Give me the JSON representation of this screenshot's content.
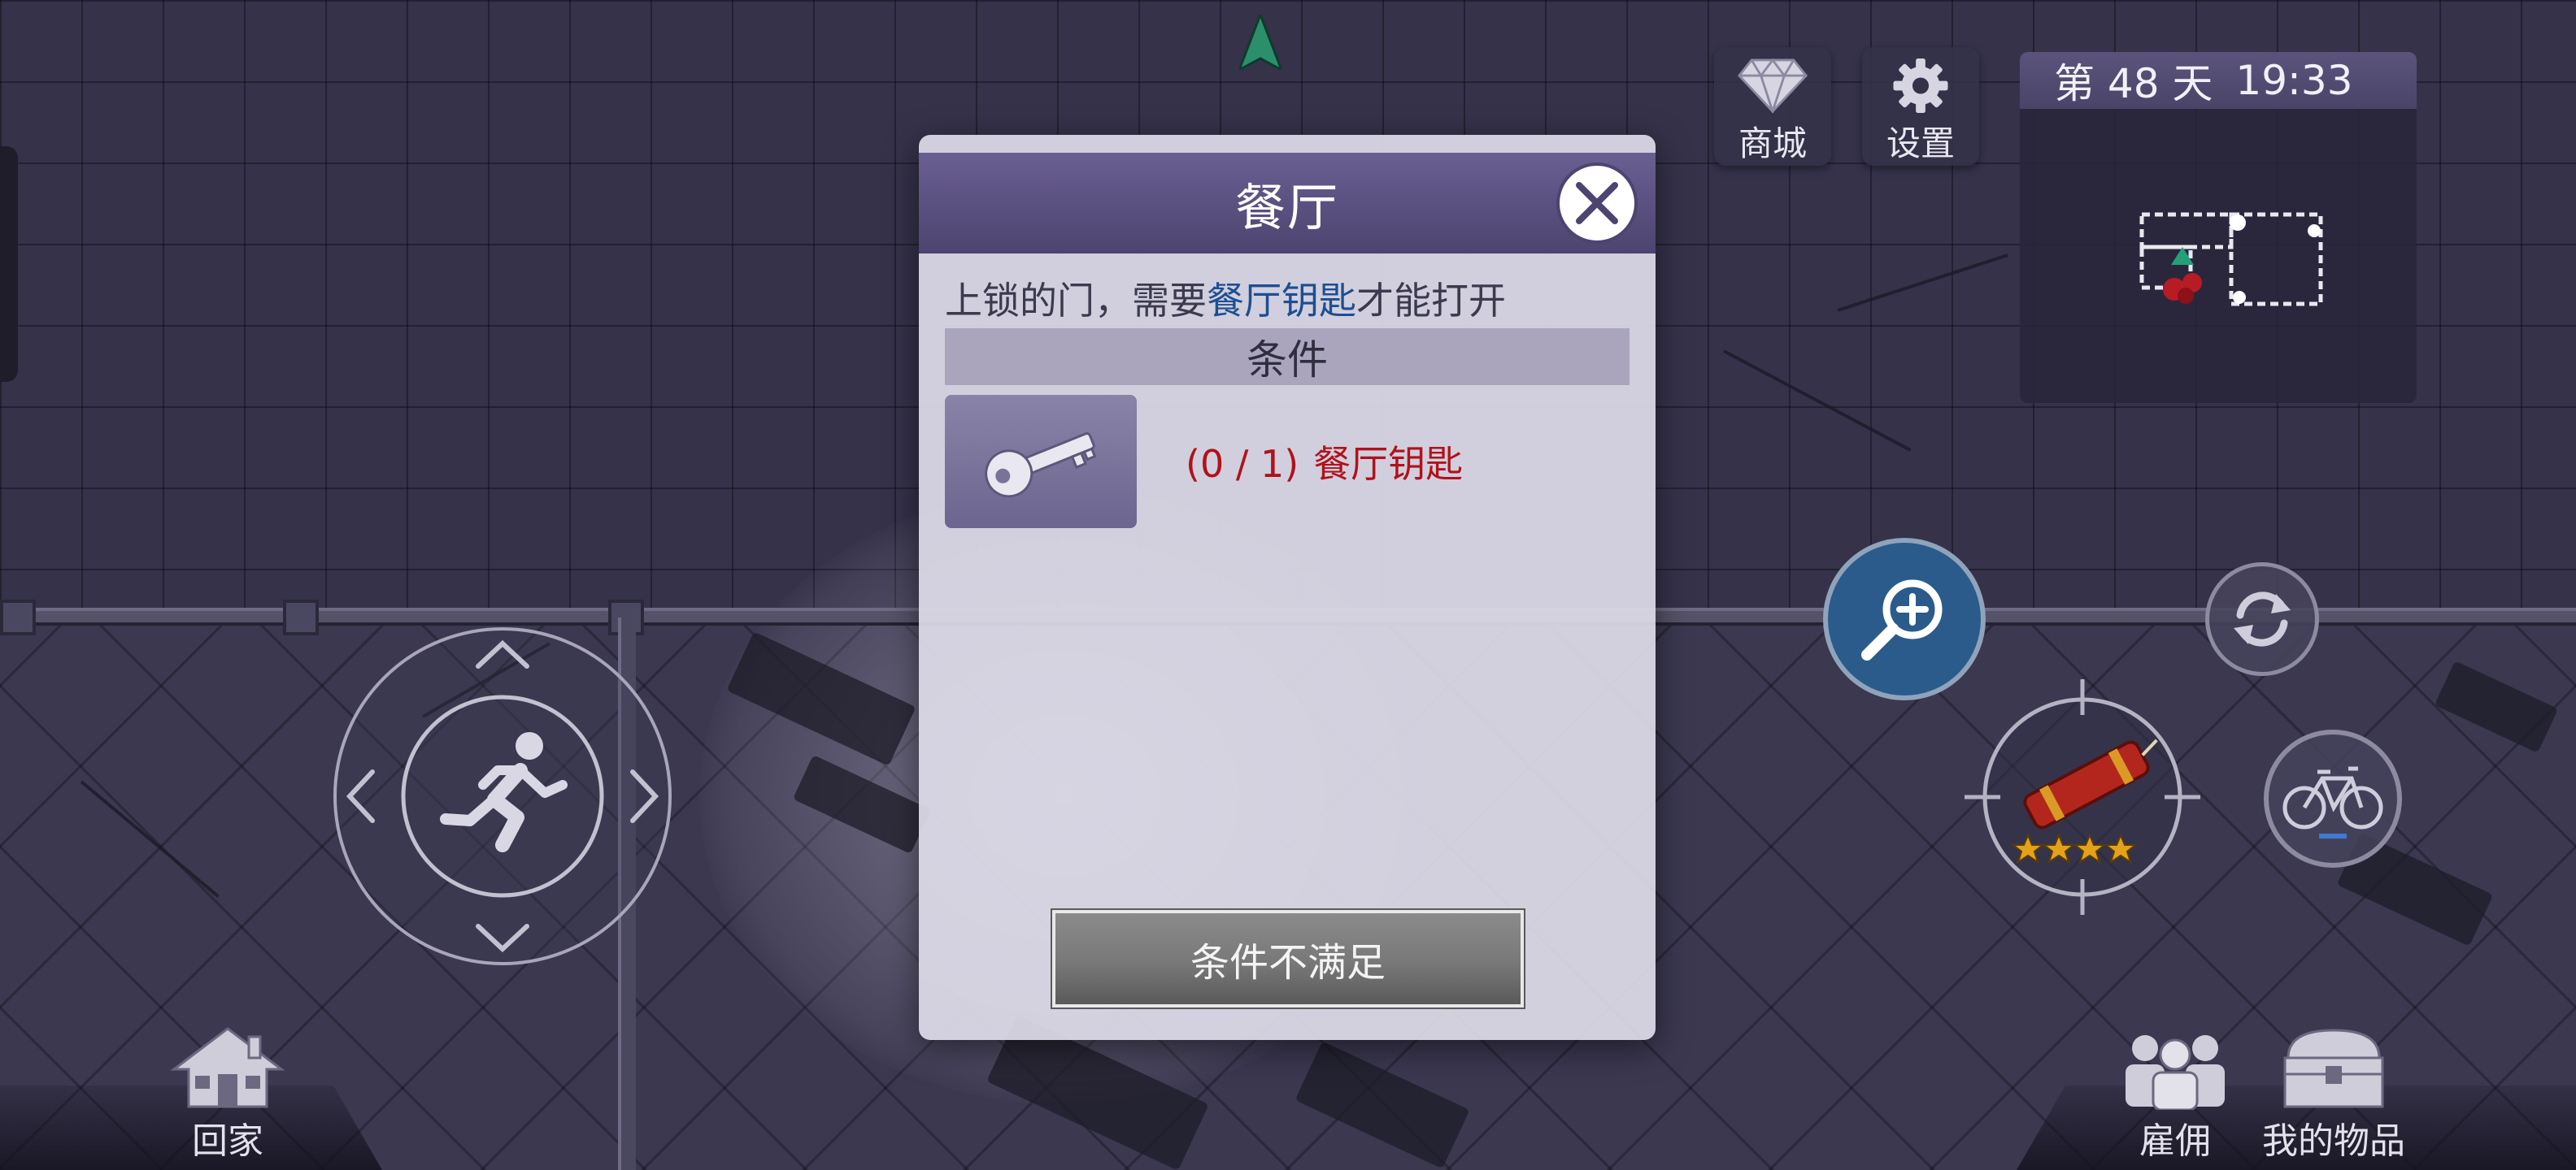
{
  "hud": {
    "shop_label": "商城",
    "settings_label": "设置",
    "day_label": "第 48 天",
    "time_label": "19:33"
  },
  "dialog": {
    "title": "餐厅",
    "desc_prefix": "上锁的门，需要",
    "desc_highlight": "餐厅钥匙",
    "desc_suffix": "才能打开",
    "section_label": "条件",
    "requirement": {
      "count": "(0 / 1)",
      "item_name": "餐厅钥匙",
      "icon": "key-icon"
    },
    "action_label": "条件不满足"
  },
  "bottom": {
    "home_label": "回家",
    "hire_label": "雇佣",
    "inventory_label": "我的物品"
  },
  "weapon": {
    "stars": 4,
    "icon": "dynamite-icon"
  },
  "colors": {
    "dialog_header": "#5a5080",
    "requirement_unmet": "#b0121b",
    "desc_highlight": "#1d4e92",
    "zoom_button": "#2b5b8a",
    "star": "#e3a21a"
  }
}
